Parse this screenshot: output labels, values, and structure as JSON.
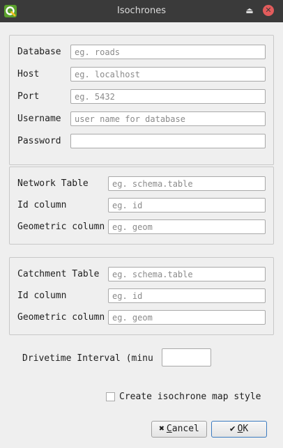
{
  "window": {
    "title": "Isochrones",
    "maximize_glyph": "⏏",
    "close_glyph": "✕"
  },
  "connection": {
    "database": {
      "label": "Database",
      "placeholder": "eg. roads",
      "value": ""
    },
    "host": {
      "label": "Host",
      "placeholder": "eg. localhost",
      "value": ""
    },
    "port": {
      "label": "Port",
      "placeholder": "eg. 5432",
      "value": ""
    },
    "username": {
      "label": "Username",
      "placeholder": "user name for database",
      "value": ""
    },
    "password": {
      "label": "Password",
      "placeholder": "",
      "value": ""
    }
  },
  "network": {
    "table": {
      "label": "Network Table",
      "placeholder": "eg. schema.table"
    },
    "id_column": {
      "label": "Id column",
      "placeholder": "eg. id"
    },
    "geom_column": {
      "label": "Geometric column",
      "placeholder": "eg. geom"
    }
  },
  "catchment": {
    "table": {
      "label": "Catchment Table",
      "placeholder": "eg. schema.table"
    },
    "id_column": {
      "label": "Id column",
      "placeholder": "eg. id"
    },
    "geom_column": {
      "label": "Geometric column",
      "placeholder": "eg. geom"
    }
  },
  "interval": {
    "label": "Drivetime Interval (minu",
    "value": ""
  },
  "style_checkbox": {
    "label": "Create isochrone map style",
    "checked": false
  },
  "buttons": {
    "cancel": {
      "icon": "✖",
      "accel": "C",
      "rest": "ancel"
    },
    "ok": {
      "icon": "✔",
      "accel": "O",
      "rest": "K"
    }
  },
  "colors": {
    "titlebar": "#3a3a3a",
    "dialog_bg": "#efefef",
    "logo_green": "#5aa02c",
    "close_red": "#e25c5c",
    "ok_border": "#3b7bc0"
  },
  "icons": {
    "logo": "qgis-logo-icon",
    "maximize": "maximize-icon",
    "close": "close-icon",
    "cancel": "cancel-x-icon",
    "ok": "checkmark-icon"
  }
}
